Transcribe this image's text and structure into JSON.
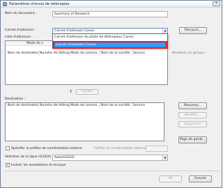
{
  "window": {
    "title": "Paramètres d'envoi de télécopies",
    "close_glyph": "✕"
  },
  "document_name": {
    "label": "Nom du document :",
    "value": "Summary of Research"
  },
  "address_book": {
    "label": "Carnet d'adresses :",
    "selected": "Carnet d'adresses Canon",
    "browse_button": "Parcourir...",
    "options": [
      "Carnet d'adresses du pilote de télécopieur Canon",
      "Carnet d'adresses Canon"
    ],
    "highlight_color": "#e21b23"
  },
  "address_list": {
    "label": "Liste d'adresses :",
    "sub_header_partial": "Mode de n",
    "columns": [
      "Nom de destination",
      "Numéro de télécop...",
      "Mode de commu...",
      "Nom de la société",
      "Service"
    ]
  },
  "group_members": {
    "label": "Membres du groupe :"
  },
  "add_button": {
    "label": "Ajouter",
    "icon": "arrow-down-icon"
  },
  "destination": {
    "label": "Destination :",
    "columns": [
      "Nom de destination",
      "Numéro de télécop...",
      "Mode de commu...",
      "Nom de la société",
      "Service"
    ],
    "new_button": "Nouveau...",
    "edit_button": "Modifier...",
    "delete_button": "Supprimer",
    "cover_page_button": "Page de garde..."
  },
  "prefix": {
    "checkbox_label": "Spécifier le préfixe de numérotation externe",
    "checked": false,
    "field_label": "Préfixe de numérotation externe :",
    "value": ""
  },
  "line": {
    "label": "Sélection de la ligne (G3/G4) :",
    "value": "Auto(G3/G4)"
  },
  "annotations": {
    "checkbox_label": "Insérer les annotations et envoyer",
    "checked": true,
    "check_glyph": "✓"
  },
  "footer": {
    "ok_button": "OK",
    "cancel_button": "Annuler"
  }
}
